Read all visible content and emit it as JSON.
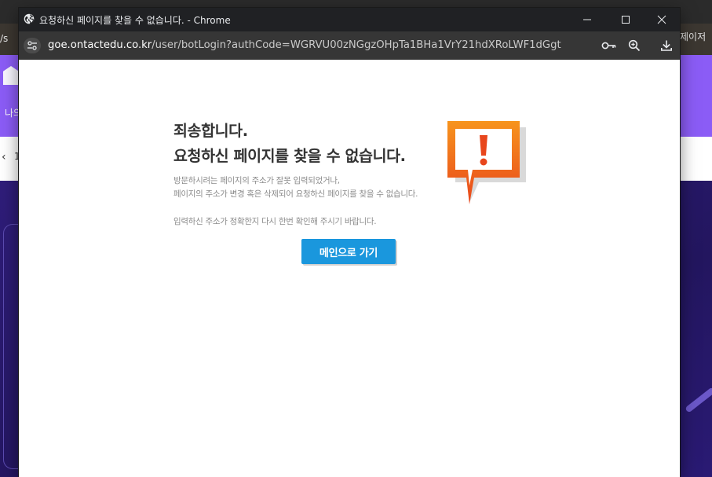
{
  "background": {
    "left_tab_text": "/s",
    "right_tab_text": "제이저",
    "nav_text": "나의",
    "page_number": "1"
  },
  "window": {
    "title": "요청하신 페이지를 찾을 수 없습니다. - Chrome",
    "url_host": "goe.ontactedu.co.kr",
    "url_path": "/user/botLogin?authCode=WGRVU00zNGgzOHpTa1BHa1VrY21hdXRoLWF1dGgt"
  },
  "error_page": {
    "heading_line1": "죄송합니다.",
    "heading_line2": "요청하신 페이지를 찾을 수 없습니다.",
    "desc_line1": "방문하시려는 페이지의 주소가 잘못 입력되었거나,",
    "desc_line2": "페이지의 주소가 변경 혹은 삭제되어 요청하신 페이지를 찾을 수 없습니다.",
    "desc_line3": "입력하신 주소가 정확한지 다시 한번 확인해 주시기 바랍니다.",
    "main_button_label": "메인으로 가기"
  },
  "colors": {
    "button_bg": "#1a97dd",
    "alert_orange": "#f26522",
    "background_purple": "#8b5cf6"
  }
}
